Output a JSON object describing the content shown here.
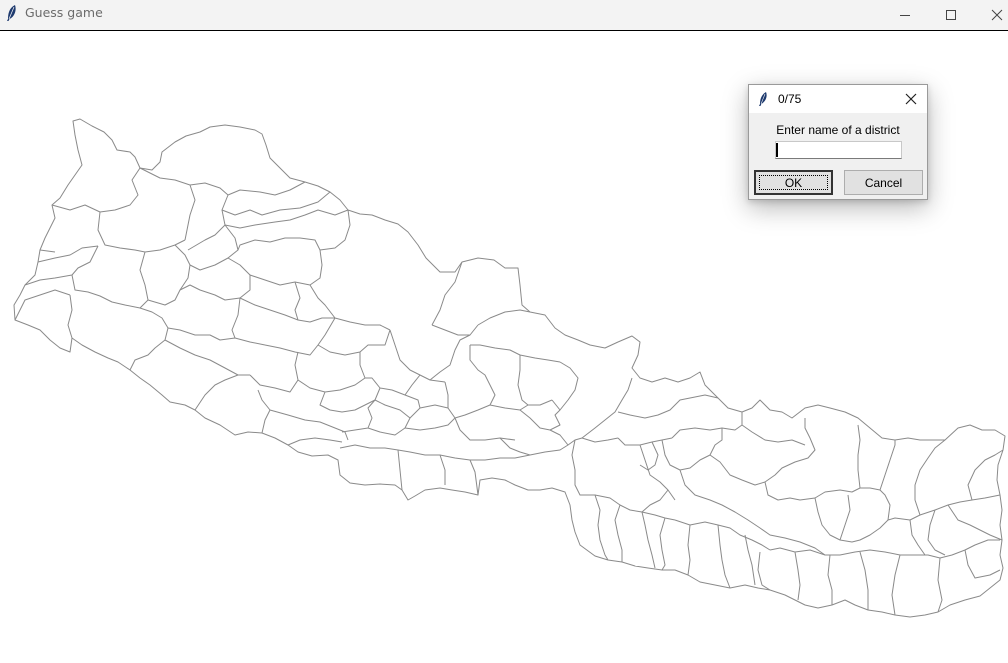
{
  "window": {
    "title": "Guess game",
    "icon": "feather-icon",
    "controls": [
      "minimize-icon",
      "maximize-icon",
      "close-icon"
    ]
  },
  "map": {
    "subject": "Nepal district outline map",
    "stroke_color": "#8a8a8a"
  },
  "dialog": {
    "title": "0/75",
    "icon": "feather-icon",
    "prompt": "Enter name of a district",
    "input_value": "",
    "ok_label": "OK",
    "cancel_label": "Cancel"
  }
}
